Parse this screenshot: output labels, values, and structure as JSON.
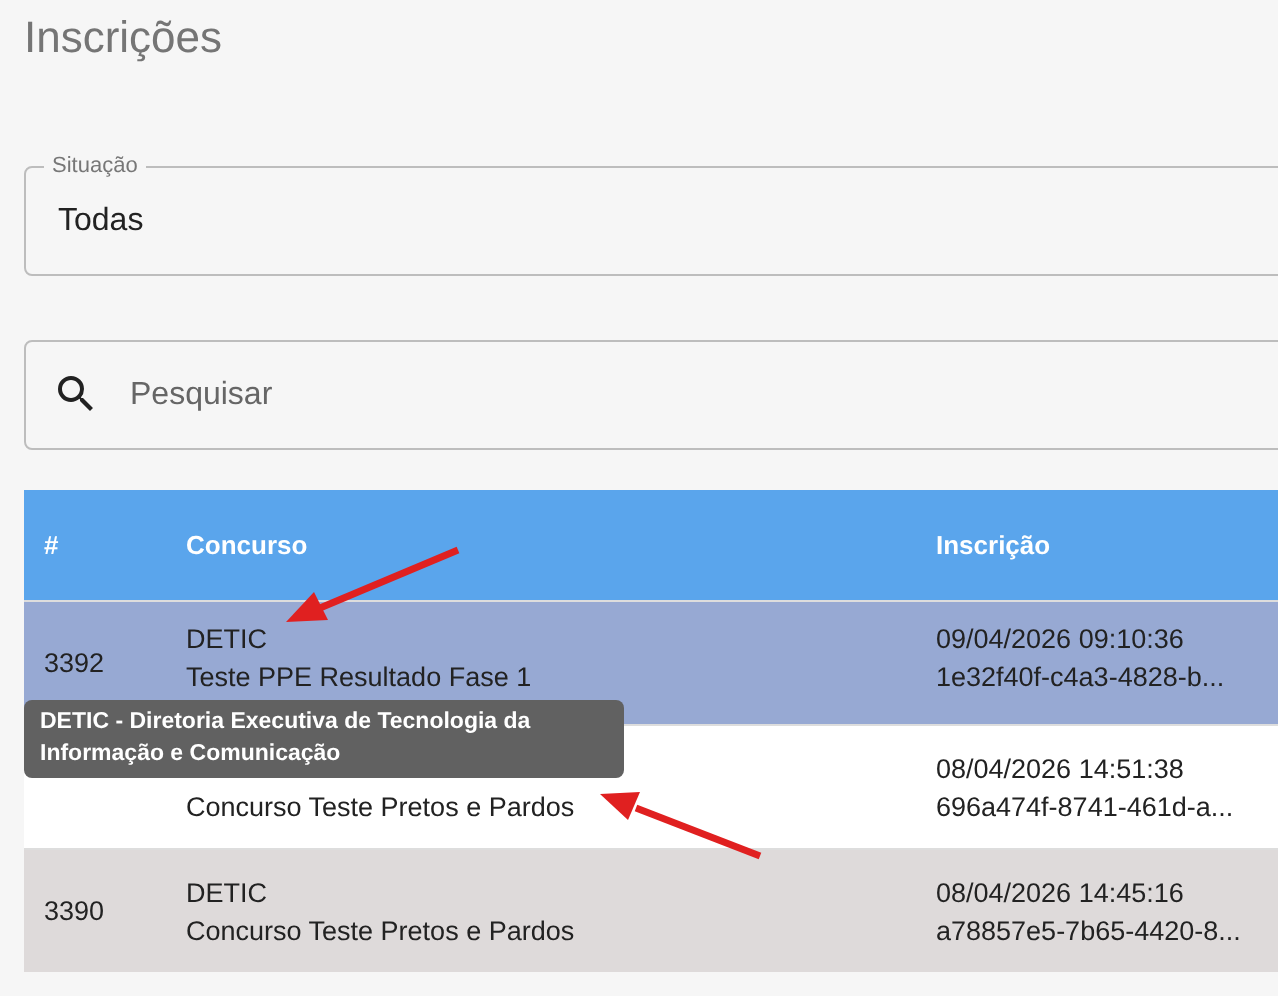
{
  "page": {
    "title": "Inscrições"
  },
  "filter": {
    "label": "Situação",
    "value": "Todas"
  },
  "search": {
    "placeholder": "Pesquisar"
  },
  "table": {
    "columns": [
      "#",
      "Concurso",
      "Inscrição"
    ],
    "rows": [
      {
        "id": "3392",
        "org": "DETIC",
        "contest": "Teste PPE Resultado Fase 1",
        "date": "09/04/2026 09:10:36",
        "code": "1e32f40f-c4a3-4828-b...",
        "selected": true,
        "shade": false
      },
      {
        "contest": "Concurso Teste Pretos e Pardos",
        "date": "08/04/2026 14:51:38",
        "code": "696a474f-8741-461d-a...",
        "selected": false,
        "shade": false
      },
      {
        "id": "3390",
        "org": "DETIC",
        "contest": "Concurso Teste Pretos e Pardos",
        "date": "08/04/2026 14:45:16",
        "code": "a78857e5-7b65-4420-8...",
        "selected": false,
        "shade": true
      }
    ]
  },
  "tooltip": {
    "text": "DETIC - Diretoria Executiva de Tecnologia da Informação e Comunicação"
  }
}
